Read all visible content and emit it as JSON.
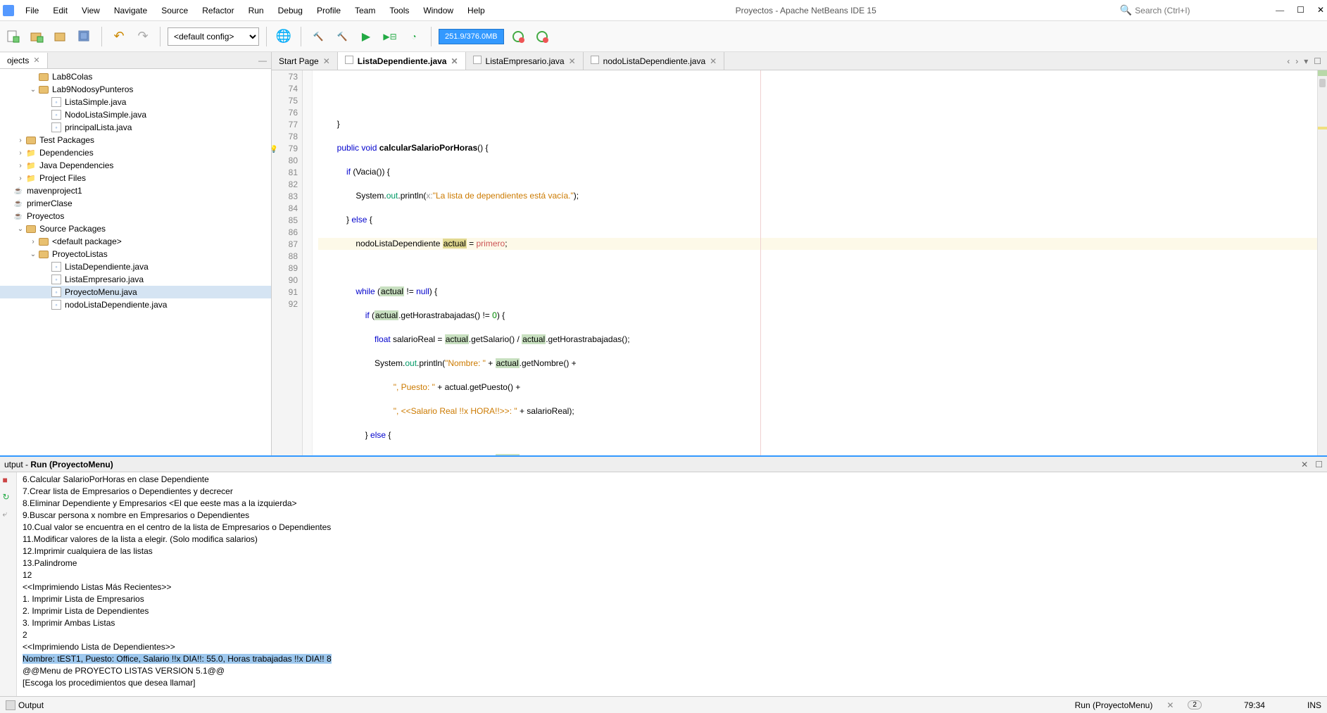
{
  "app_title": "Proyectos - Apache NetBeans IDE 15",
  "menu": [
    "File",
    "Edit",
    "View",
    "Navigate",
    "Source",
    "Refactor",
    "Run",
    "Debug",
    "Profile",
    "Team",
    "Tools",
    "Window",
    "Help"
  ],
  "search_placeholder": "Search (Ctrl+I)",
  "toolbar": {
    "config_selected": "<default config>",
    "memory": "251.9/376.0MB"
  },
  "sidebar": {
    "tab_label": "ojects",
    "tree": [
      {
        "indent": 2,
        "arrow": "",
        "type": "pkg",
        "label": "Lab8Colas"
      },
      {
        "indent": 2,
        "arrow": "v",
        "type": "pkg",
        "label": "Lab9NodosyPunteros"
      },
      {
        "indent": 3,
        "arrow": "",
        "type": "java",
        "label": "ListaSimple.java"
      },
      {
        "indent": 3,
        "arrow": "",
        "type": "java",
        "label": "NodoListaSimple.java"
      },
      {
        "indent": 3,
        "arrow": "",
        "type": "java",
        "label": "principalLista.java"
      },
      {
        "indent": 1,
        "arrow": ">",
        "type": "pkg",
        "label": "Test Packages"
      },
      {
        "indent": 1,
        "arrow": ">",
        "type": "folder",
        "label": "Dependencies"
      },
      {
        "indent": 1,
        "arrow": ">",
        "type": "folder",
        "label": "Java Dependencies"
      },
      {
        "indent": 1,
        "arrow": ">",
        "type": "folder",
        "label": "Project Files"
      },
      {
        "indent": 0,
        "arrow": "",
        "type": "cup",
        "label": "mavenproject1"
      },
      {
        "indent": 0,
        "arrow": "",
        "type": "cup",
        "label": "primerClase"
      },
      {
        "indent": 0,
        "arrow": "",
        "type": "cup",
        "label": "Proyectos"
      },
      {
        "indent": 1,
        "arrow": "v",
        "type": "pkg",
        "label": "Source Packages"
      },
      {
        "indent": 2,
        "arrow": ">",
        "type": "pkg",
        "label": "<default package>"
      },
      {
        "indent": 2,
        "arrow": "v",
        "type": "pkg",
        "label": "ProyectoListas"
      },
      {
        "indent": 3,
        "arrow": "",
        "type": "java",
        "label": "ListaDependiente.java"
      },
      {
        "indent": 3,
        "arrow": "",
        "type": "java",
        "label": "ListaEmpresario.java"
      },
      {
        "indent": 3,
        "arrow": "",
        "type": "java",
        "label": "ProyectoMenu.java",
        "selected": true
      },
      {
        "indent": 3,
        "arrow": "",
        "type": "java",
        "label": "nodoListaDependiente.java"
      }
    ]
  },
  "editor": {
    "tabs": [
      {
        "label": "Start Page",
        "kind": "start",
        "active": false
      },
      {
        "label": "ListaDependiente.java",
        "kind": "java",
        "active": true
      },
      {
        "label": "ListaEmpresario.java",
        "kind": "java",
        "active": false
      },
      {
        "label": "nodoListaDependiente.java",
        "kind": "java",
        "active": false
      }
    ],
    "lines_start": 73,
    "lines_end": 92,
    "hint_line": 79
  },
  "output": {
    "title_prefix": "utput - ",
    "title_bold": "Run (ProyectoMenu)",
    "lines": [
      "6.Calcular SalarioPorHoras en clase Dependiente",
      "7.Crear lista de Empresarios o Dependientes y decrecer",
      "8.Eliminar Dependiente y Empresarios <El que eeste mas a la izquierda>",
      "9.Buscar persona x nombre en Empresarios o Dependientes",
      "10.Cual valor se encuentra en el centro de la lista de Empresarios o Dependientes",
      "11.Modificar valores de la lista a elegir. (Solo modifica salarios)",
      "12.Imprimir cualquiera de las listas",
      "13.Palindrome",
      "12",
      "<<Imprimiendo Listas Más Recientes>>",
      "1. Imprimir Lista de Empresarios",
      "2. Imprimir Lista de Dependientes",
      "3. Imprimir Ambas Listas",
      "2",
      "<<Imprimiendo Lista de Dependientes>>"
    ],
    "highlighted": "Nombre: tEST1, Puesto: Office, Salario !!x DIA!!: 55.0, Horas trabajadas !!x DIA!! 8",
    "lines_after": [
      "@@Menu de PROYECTO LISTAS VERSION 5.1@@",
      "[Escoga los procedimientos que desea llamar]"
    ]
  },
  "statusbar": {
    "output_btn": "Output",
    "running": "Run (ProyectoMenu)",
    "notif_count": "2",
    "cursor": "79:34",
    "mode": "INS"
  }
}
